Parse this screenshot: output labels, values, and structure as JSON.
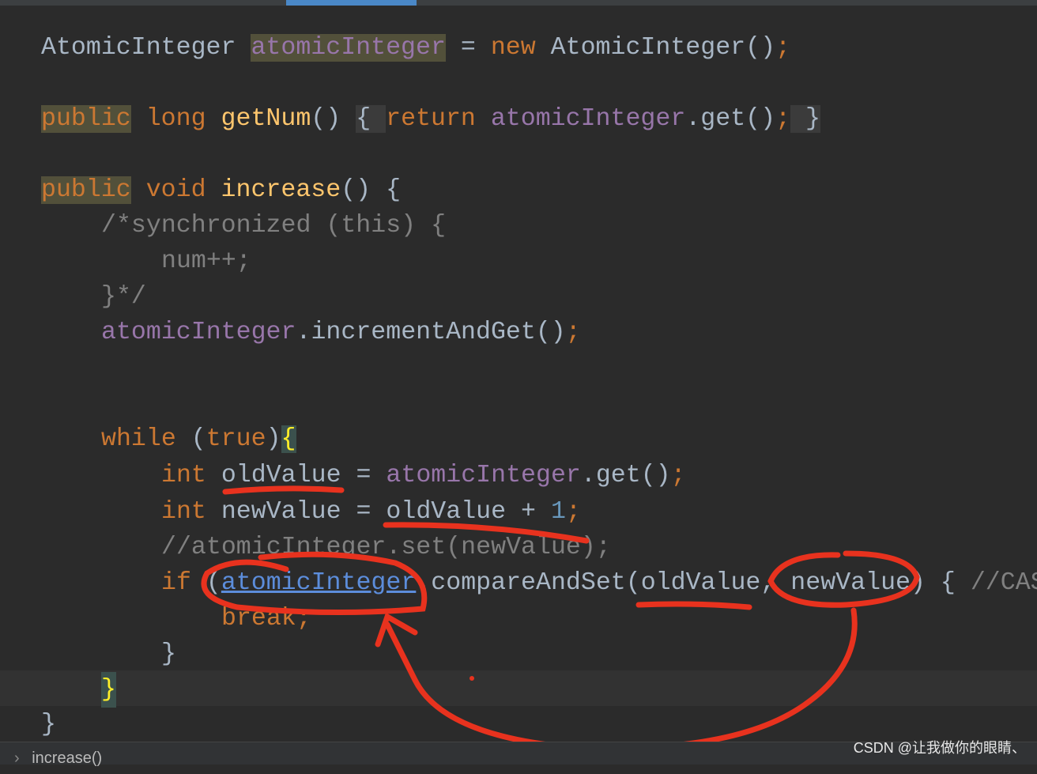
{
  "editor": {
    "lines": {
      "l1": {
        "t1": "AtomicInteger ",
        "t2": "atomicInteger",
        "t3": " = ",
        "t4": "new",
        "t5": " AtomicInteger()",
        "t6": ";"
      },
      "l2": {
        "t1": "public",
        "t2": " long ",
        "t3": "getNum",
        "t4": "() ",
        "t5": "{ ",
        "t6": "return",
        "t7": " atomicInteger",
        "t8": ".get()",
        "t9": ";",
        "t10": " }"
      },
      "l3": {
        "t1": "public",
        "t2": " void ",
        "t3": "increase",
        "t4": "() {"
      },
      "l4": "/*synchronized (this) {",
      "l5": "num++;",
      "l6": "}*/",
      "l7": {
        "t1": "atomicInteger",
        "t2": ".incrementAndGet()",
        "t3": ";"
      },
      "l8": {
        "t1": "while",
        "t2": " (",
        "t3": "true",
        "t4": ")",
        "t5": "{"
      },
      "l9": {
        "t1": "int",
        "t2": " oldValue = ",
        "t3": "atomicInteger",
        "t4": ".get()",
        "t5": ";"
      },
      "l10": {
        "t1": "int",
        "t2": " newValue = oldValue + ",
        "t3": "1",
        "t4": ";"
      },
      "l11": "//atomicInteger.set(newValue);",
      "l12": {
        "t1": "if",
        "t2": " (",
        "t3": "atomicInteger",
        "t4": ".compareAndSet(oldValue, newValue) { ",
        "t5": "//CAS"
      },
      "l13": {
        "t1": "break",
        "t2": ";"
      },
      "l14": "}",
      "l15": "}",
      "l16": "}"
    }
  },
  "breadcrumb": "increase()",
  "watermark": "CSDN @让我做你的眼睛、",
  "colors": {
    "background": "#2b2b2b",
    "keyword": "#cc7832",
    "field": "#9876aa",
    "annotation": "#e8321e"
  }
}
